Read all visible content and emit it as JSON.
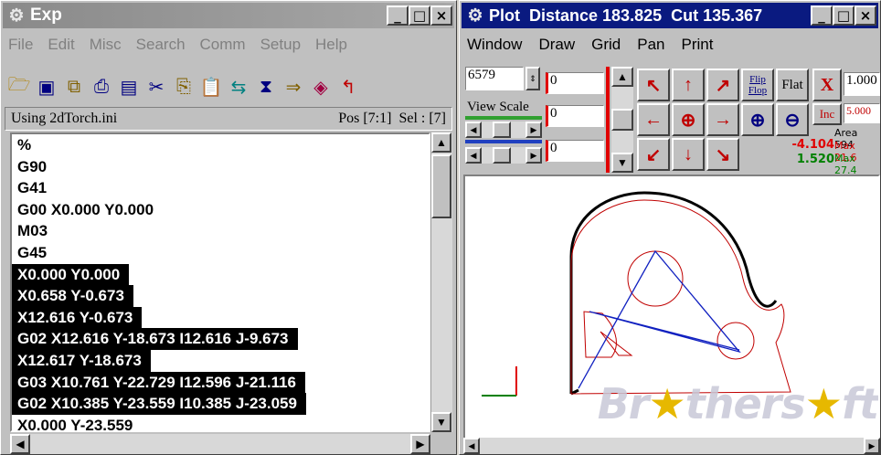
{
  "left_window": {
    "title": "Exp",
    "menu": [
      "File",
      "Edit",
      "Misc",
      "Search",
      "Comm",
      "Setup",
      "Help"
    ],
    "status_file": "Using 2dTorch.ini",
    "status_pos": "Pos [7:1]",
    "status_sel": "Sel : [7]",
    "lines": [
      {
        "text": "%",
        "selected": false
      },
      {
        "text": "G90",
        "selected": false
      },
      {
        "text": "G41",
        "selected": false
      },
      {
        "text": "G00 X0.000 Y0.000",
        "selected": false
      },
      {
        "text": "M03",
        "selected": false
      },
      {
        "text": "G45",
        "selected": false
      },
      {
        "text": "X0.000 Y0.000",
        "selected": true
      },
      {
        "text": "X0.658 Y-0.673",
        "selected": true
      },
      {
        "text": "X12.616 Y-0.673",
        "selected": true
      },
      {
        "text": "G02 X12.616 Y-18.673 I12.616 J-9.673",
        "selected": true
      },
      {
        "text": "X12.617 Y-18.673",
        "selected": true
      },
      {
        "text": "G03 X10.761 Y-22.729 I12.596 J-21.116",
        "selected": true
      },
      {
        "text": "G02 X10.385 Y-23.559 I10.385 J-23.059",
        "selected": true
      },
      {
        "text": "X0.000 Y-23.559",
        "selected": false
      }
    ]
  },
  "right_window": {
    "title": "Plot  Distance 183.825  Cut 135.367",
    "menu": [
      "Window",
      "Draw",
      "Grid",
      "Pan",
      "Print"
    ],
    "counter": "6579",
    "view_scale": "View Scale",
    "field1": "0",
    "field2": "0",
    "field3": "0",
    "flip_flop_1": "Flip",
    "flip_flop_2": "Flop",
    "flat": "Flat",
    "x_label": "X",
    "x_value": "1.000",
    "inc_label": "Inc",
    "inc_value": "5.000",
    "area": "Area 594",
    "val_red": "-4.104",
    "val_green": "1.520",
    "max1": "Max 21.6",
    "max2": "Max 27.4"
  },
  "watermark": {
    "pre": "Br",
    "mid": "thers",
    "end": "ft"
  }
}
